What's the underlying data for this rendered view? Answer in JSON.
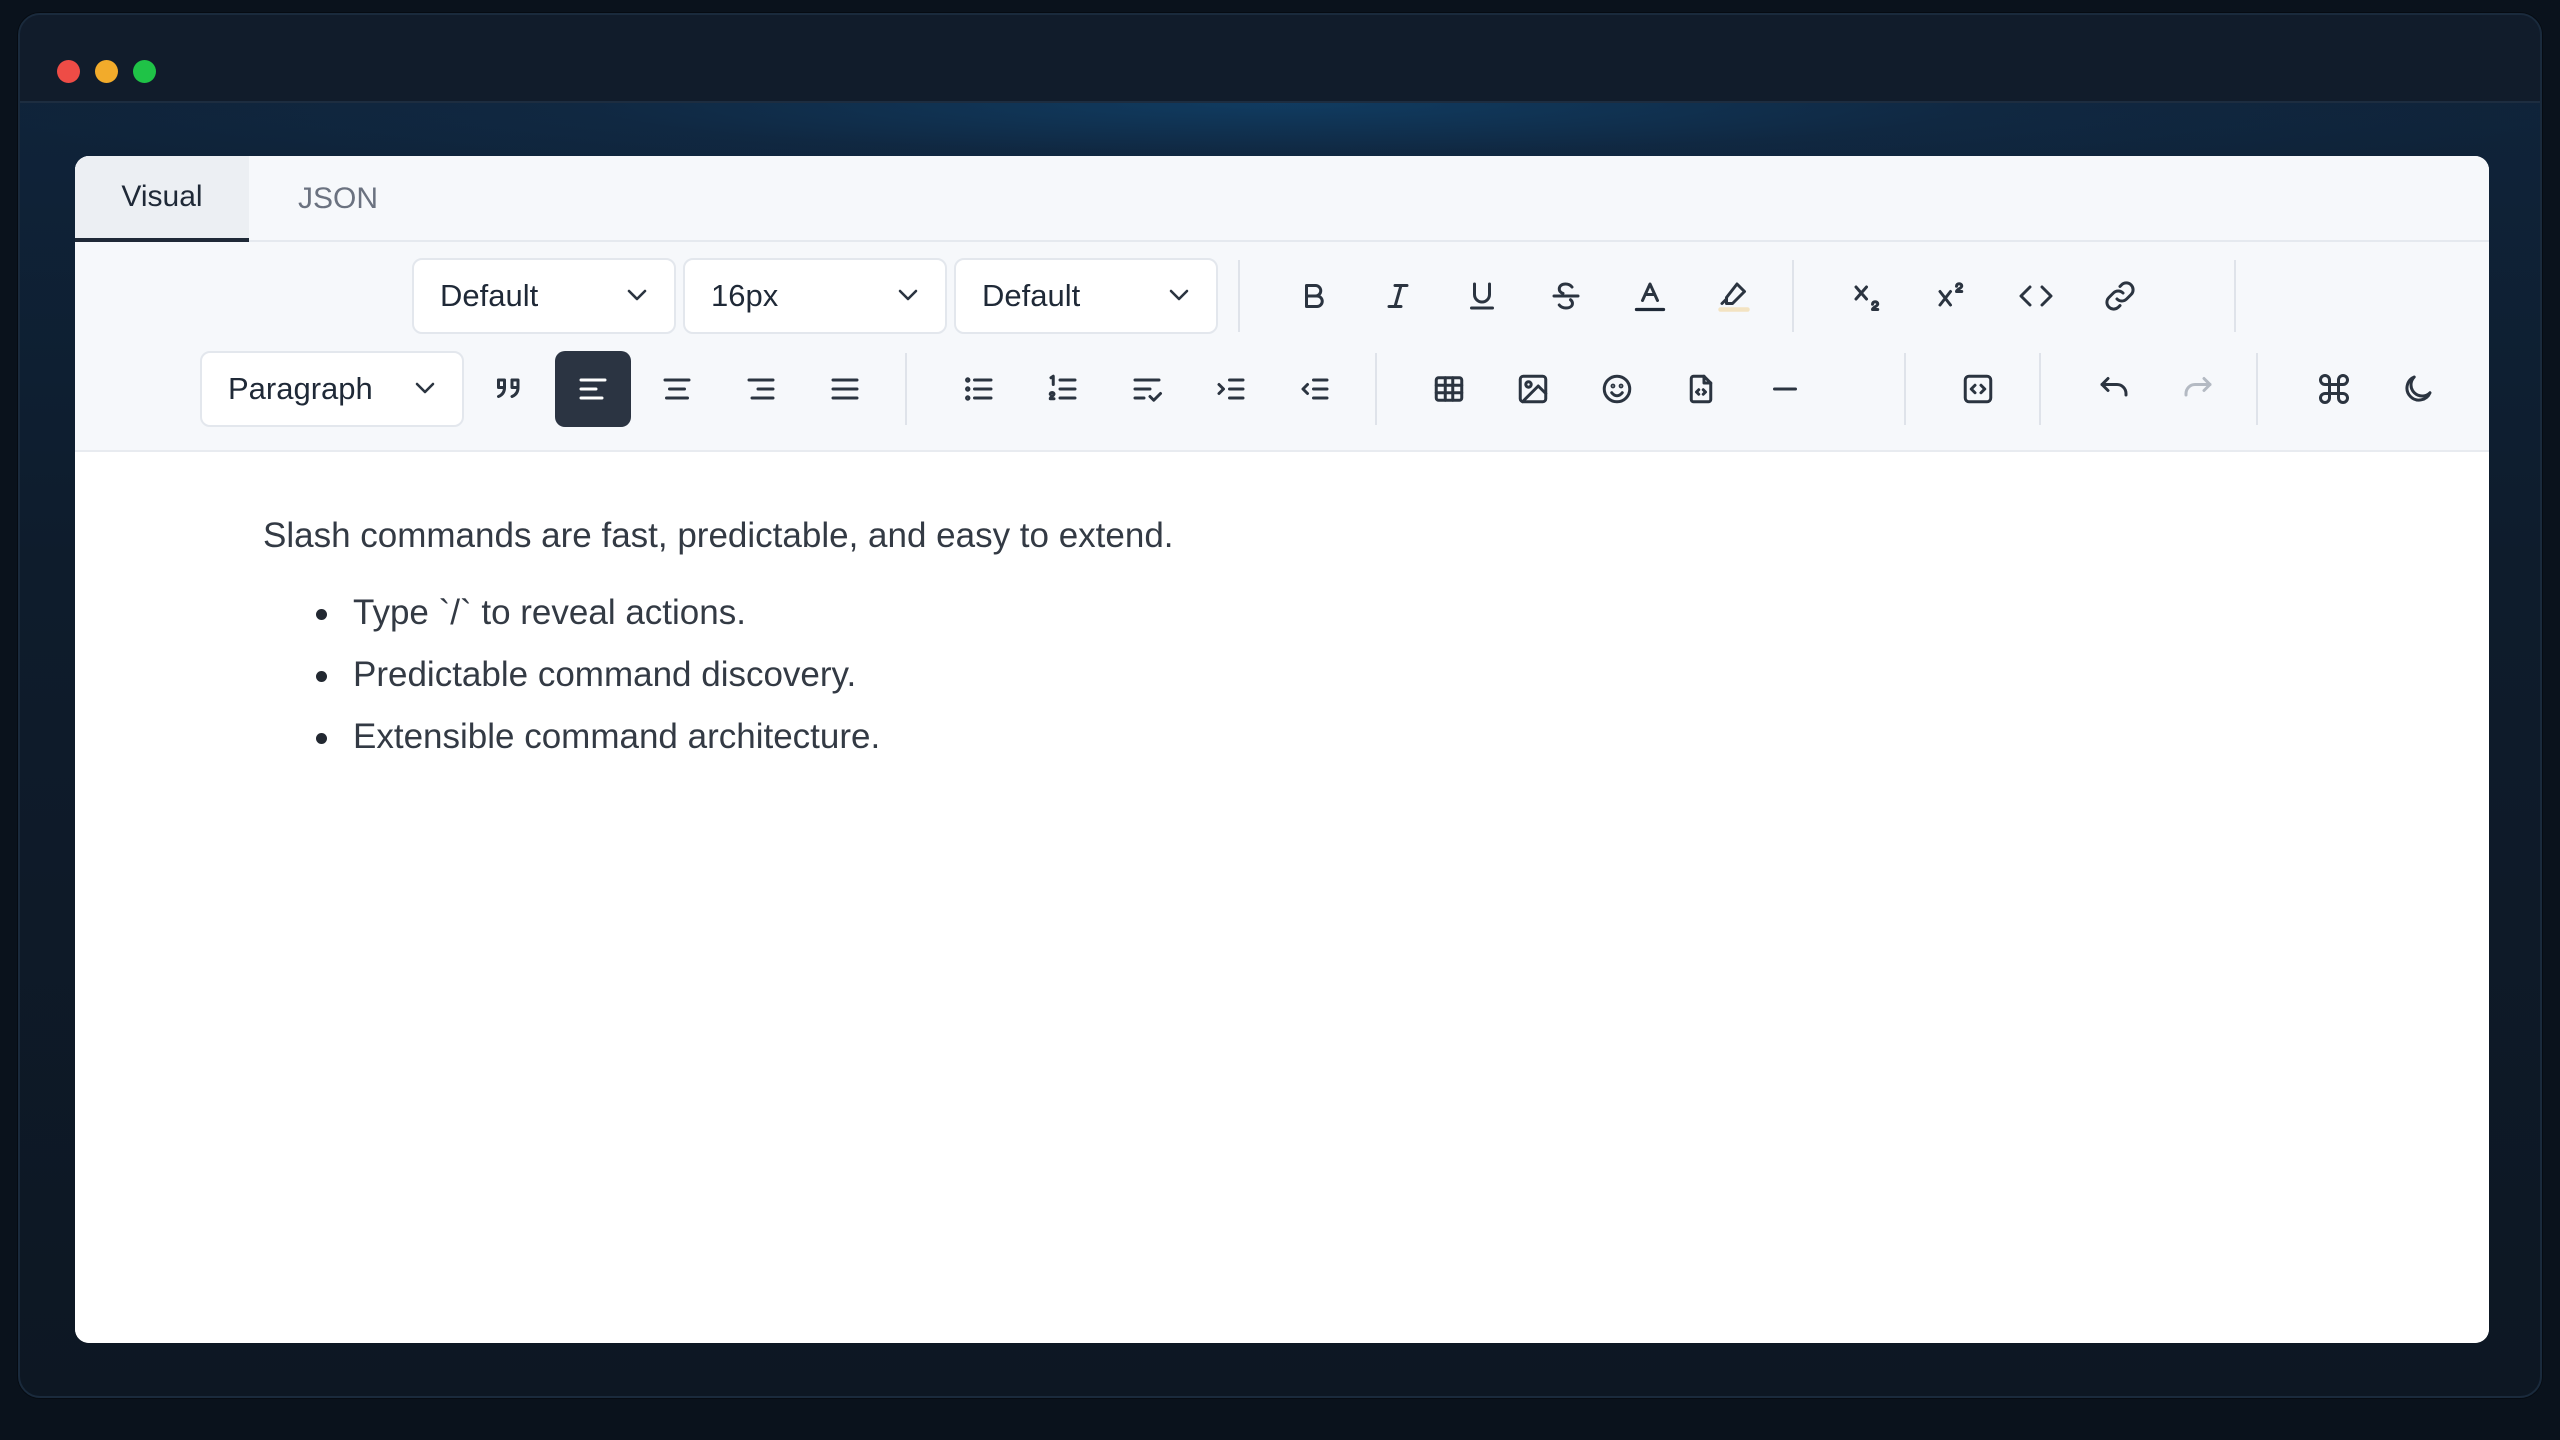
{
  "window": {
    "title": ""
  },
  "tabs": [
    {
      "label": "Visual",
      "active": true
    },
    {
      "label": "JSON",
      "active": false
    }
  ],
  "toolbar": {
    "font_family": "Default",
    "font_size": "16px",
    "line_height": "Default",
    "block_type": "Paragraph",
    "row1_icons": [
      "bold-icon",
      "italic-icon",
      "underline-icon",
      "strikethrough-icon",
      "text-color-icon",
      "highlight-icon",
      "subscript-icon",
      "superscript-icon",
      "inline-code-icon",
      "link-icon"
    ],
    "row2_icons": [
      "blockquote-icon",
      "align-left-icon",
      "align-center-icon",
      "align-right-icon",
      "align-justify-icon",
      "bullet-list-icon",
      "ordered-list-icon",
      "task-list-icon",
      "indent-icon",
      "outdent-icon",
      "table-icon",
      "image-icon",
      "emoji-icon",
      "file-icon",
      "horizontal-rule-icon",
      "code-block-icon",
      "undo-icon",
      "redo-icon",
      "command-icon",
      "dark-mode-icon"
    ],
    "active_alignment": "left",
    "text_color_underline": "#1f2937",
    "highlight_underline": "#f3e3c2"
  },
  "document": {
    "paragraph": "Slash commands are fast, predictable, and easy to extend.",
    "bullets": [
      "Type `/` to reveal actions.",
      "Predictable command discovery.",
      "Extensible command architecture."
    ]
  }
}
